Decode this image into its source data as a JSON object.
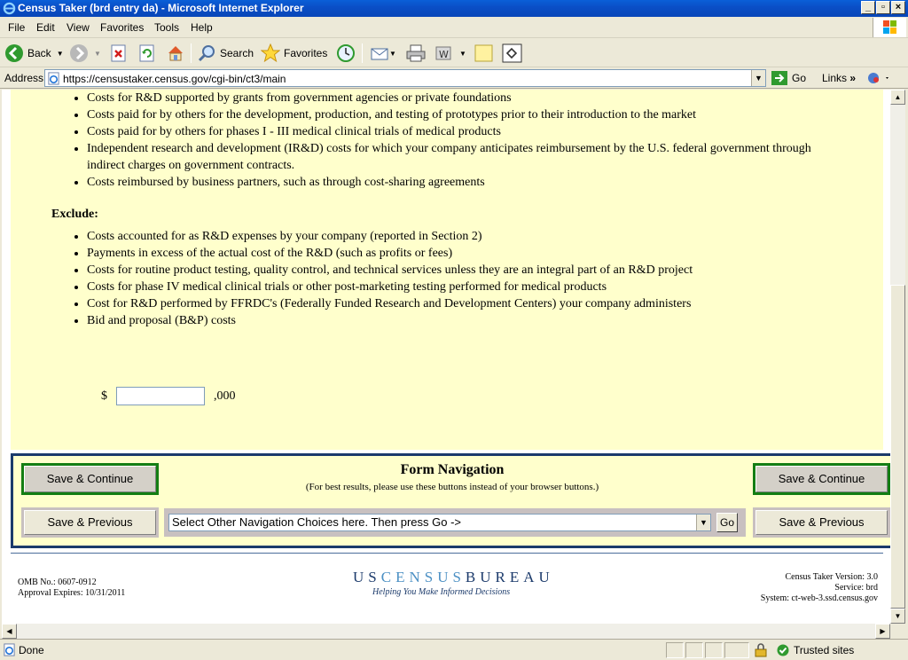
{
  "window": {
    "title": "Census Taker (brd entry da) - Microsoft Internet Explorer"
  },
  "menu": [
    "File",
    "Edit",
    "View",
    "Favorites",
    "Tools",
    "Help"
  ],
  "toolbar": {
    "back": "Back",
    "search": "Search",
    "favorites": "Favorites"
  },
  "address": {
    "label": "Address",
    "url": "https://censustaker.census.gov/cgi-bin/ct3/main",
    "go": "Go",
    "links": "Links"
  },
  "include_items": [
    "Costs for R&D supported by grants from government agencies or private foundations",
    "Costs paid for by others for the development, production, and testing of prototypes prior to their introduction to the market",
    "Costs paid for by others for phases I - III medical clinical trials of medical products",
    "Independent research and development (IR&D) costs for which your company anticipates reimbursement by the U.S. federal government through indirect charges on government contracts.",
    "Costs reimbursed by business partners, such as through cost-sharing agreements"
  ],
  "exclude_label": "Exclude:",
  "exclude_items": [
    "Costs accounted for as R&D expenses by your company (reported in Section 2)",
    "Payments in excess of the actual cost of the R&D (such as profits or fees)",
    "Costs for routine product testing, quality control, and technical services unless they are an integral part of an R&D project",
    "Costs for phase IV medical clinical trials or other post-marketing testing performed for medical products",
    "Cost for R&D performed by FFRDC's (Federally Funded Research and Development Centers) your company administers",
    "Bid and proposal (B&P) costs"
  ],
  "amount": {
    "prefix": "$",
    "suffix": ",000",
    "value": ""
  },
  "nav": {
    "title": "Form Navigation",
    "subtitle": "(For best results, please use these buttons instead of your browser buttons.)",
    "save_continue": "Save & Continue",
    "save_previous": "Save & Previous",
    "select_text": "Select Other Navigation Choices here. Then press Go ->",
    "go": "Go"
  },
  "footer": {
    "omb": "OMB No.: 0607-0912",
    "approval": "Approval Expires: 10/31/2011",
    "logo_us": "US",
    "logo_census": "CENSUS",
    "logo_bureau": "BUREAU",
    "tagline": "Helping You Make Informed Decisions",
    "version": "Census Taker Version: 3.0",
    "service": "Service: brd",
    "system": "System: ct-web-3.ssd.census.gov"
  },
  "status": {
    "text": "Done",
    "zone": "Trusted sites"
  }
}
